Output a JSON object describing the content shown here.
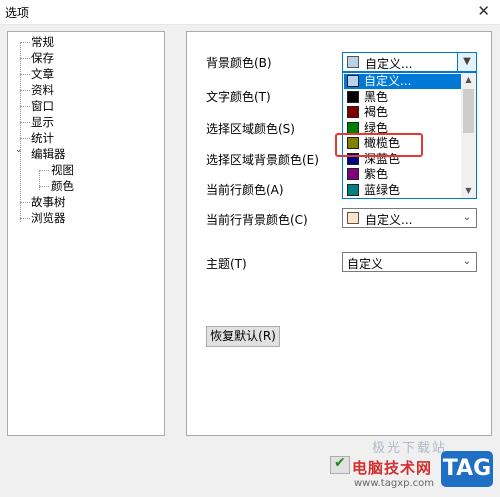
{
  "window": {
    "title": "选项",
    "close_glyph": "✕"
  },
  "tree": {
    "items": [
      "常规",
      "保存",
      "文章",
      "资料",
      "窗口",
      "显示",
      "统计",
      "编辑器",
      "视图",
      "颜色",
      "故事树",
      "浏览器"
    ],
    "expander": "⌄"
  },
  "labels": {
    "bg_color": "背景颜色(B)",
    "text_color": "文字颜色(T)",
    "selection_color": "选择区域颜色(S)",
    "selection_bg_color": "选择区域背景颜色(E)",
    "current_line_color": "当前行颜色(A)",
    "current_line_bg_color": "当前行背景颜色(C)",
    "theme": "主题(T)"
  },
  "combos": {
    "bg_color": {
      "value": "自定义...",
      "swatch": "#b9d1ea"
    },
    "current_line_bg": {
      "value": "自定义...",
      "swatch": "#ffe3c8"
    },
    "theme": {
      "value": "自定义"
    }
  },
  "dropdown": {
    "options": [
      {
        "label": "自定义...",
        "color": "#b9d1ea",
        "selected": true
      },
      {
        "label": "黑色",
        "color": "#000000"
      },
      {
        "label": "褐色",
        "color": "#800000"
      },
      {
        "label": "绿色",
        "color": "#008000"
      },
      {
        "label": "橄榄色",
        "color": "#808000"
      },
      {
        "label": "深蓝色",
        "color": "#000080"
      },
      {
        "label": "紫色",
        "color": "#800080"
      },
      {
        "label": "蓝绿色",
        "color": "#008080"
      }
    ]
  },
  "buttons": {
    "restore_defaults": "恢复默认(R)"
  },
  "watermark": {
    "line1": "电脑技术网",
    "line2": "www.tagxp.com",
    "top": "极光下载站",
    "tag": "TAG"
  },
  "colors": {
    "accent": "#0078d7",
    "highlight": "#e53935"
  }
}
